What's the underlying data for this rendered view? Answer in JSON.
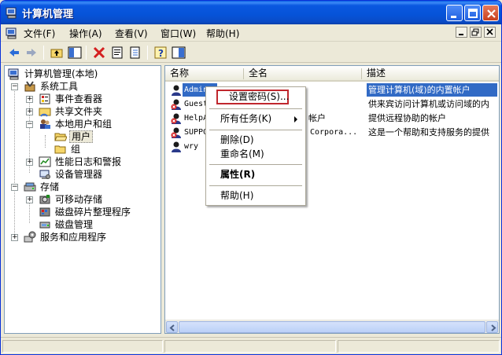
{
  "window": {
    "title": "计算机管理"
  },
  "menubar": {
    "items": [
      "文件(F)",
      "操作(A)",
      "查看(V)",
      "窗口(W)",
      "帮助(H)"
    ]
  },
  "tree": {
    "root": "计算机管理(本地)",
    "system_tools": "系统工具",
    "event_viewer": "事件查看器",
    "shared_folders": "共享文件夹",
    "local_users": "本地用户和组",
    "users": "用户",
    "groups": "组",
    "perf_logs": "性能日志和警报",
    "device_manager": "设备管理器",
    "storage": "存储",
    "removable": "可移动存储",
    "defrag": "磁盘碎片整理程序",
    "disk_mgmt": "磁盘管理",
    "services": "服务和应用程序"
  },
  "list": {
    "columns": [
      "名称",
      "全名",
      "描述"
    ],
    "rows": [
      {
        "name": "Admin",
        "fullname": "",
        "desc": "管理计算机(域)的内置帐户"
      },
      {
        "name": "Guest",
        "fullname": "",
        "desc": "供来宾访问计算机或访问域的内"
      },
      {
        "name": "HelpA",
        "fullname": "帐户",
        "desc": "提供远程协助的帐户"
      },
      {
        "name": "SUPPO",
        "fullname": "Corpora...",
        "desc": "这是一个帮助和支持服务的提供"
      },
      {
        "name": "wry",
        "fullname": "",
        "desc": ""
      }
    ]
  },
  "context_menu": {
    "set_password": "设置密码(S)...",
    "all_tasks": "所有任务(K)",
    "delete": "删除(D)",
    "rename": "重命名(M)",
    "properties": "属性(R)",
    "help": "帮助(H)"
  },
  "colors": {
    "title_blue": "#0653D8",
    "selection": "#316AC5",
    "highlight_border": "#C0272D"
  }
}
